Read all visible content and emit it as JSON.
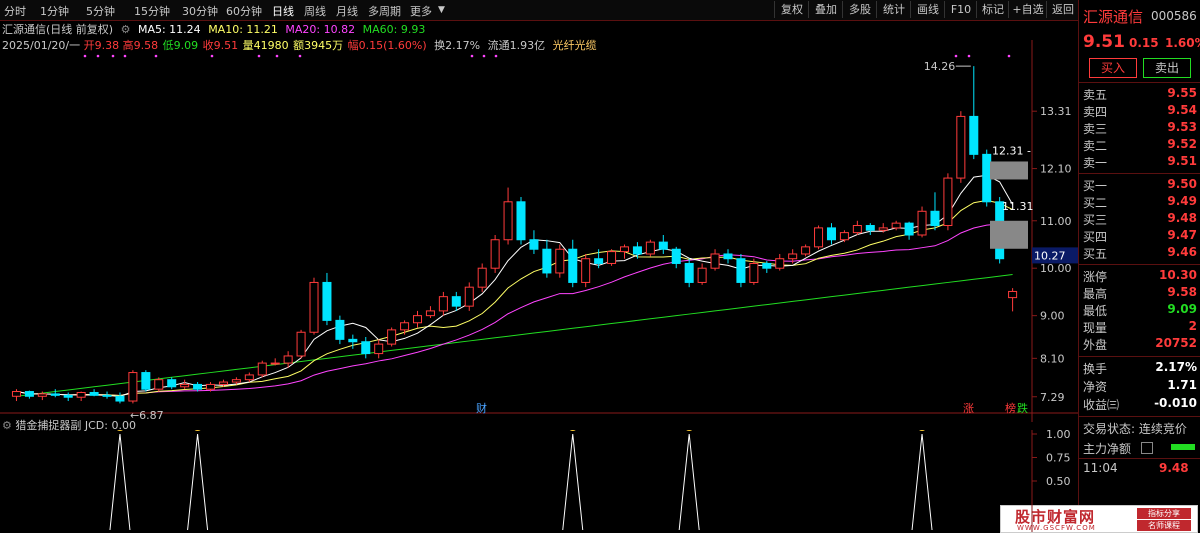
{
  "toolbar": {
    "periods": [
      "分时",
      "1分钟",
      "5分钟",
      "15分钟",
      "30分钟",
      "60分钟",
      "日线",
      "周线",
      "月线",
      "多周期",
      "更多"
    ],
    "active_period": "日线",
    "actions": [
      "复权",
      "叠加",
      "多股",
      "统计",
      "画线",
      "F10",
      "标记",
      "+自选",
      "返回"
    ]
  },
  "info": {
    "name": "汇源通信(日线 前复权)",
    "ma5": "MA5: 11.24",
    "ma10": "MA10: 11.21",
    "ma20": "MA20: 10.82",
    "ma60": "MA60: 9.93",
    "date": "2025/01/20/一",
    "open": "开9.38",
    "high": "高9.58",
    "low": "低9.09",
    "close": "收9.51",
    "volume": "量41980",
    "amount": "额3945万",
    "change": "幅0.15(1.60%)",
    "turnover": "换2.17%",
    "float_mv": "流通1.93亿",
    "concept": "光纤光缆"
  },
  "price_axis": [
    "13.31",
    "12.10",
    "11.00",
    "10.00",
    "9.00",
    "8.10",
    "7.29"
  ],
  "annotations": {
    "high_label": "14.26",
    "low_label": "6.87",
    "current_level": "10.27",
    "l1": "12.31",
    "l2": "11.31",
    "cai": "财",
    "zhang": "涨",
    "bang": "榜",
    "die": "跌"
  },
  "colors": {
    "up": "#ff3b3b",
    "down": "#00e5ff",
    "ma5": "#ffffff",
    "ma10": "#ffff66",
    "ma20": "#ff44ff",
    "ma60": "#22dd22",
    "accent": "#ff3b3b"
  },
  "chart_data": {
    "type": "candlestick",
    "ylim": [
      6.8,
      14.6
    ],
    "candles": [
      [
        7.3,
        7.45,
        7.2,
        7.4
      ],
      [
        7.4,
        7.42,
        7.25,
        7.3
      ],
      [
        7.3,
        7.4,
        7.22,
        7.35
      ],
      [
        7.35,
        7.45,
        7.28,
        7.32
      ],
      [
        7.32,
        7.38,
        7.2,
        7.28
      ],
      [
        7.28,
        7.4,
        7.2,
        7.38
      ],
      [
        7.38,
        7.45,
        7.3,
        7.32
      ],
      [
        7.32,
        7.4,
        7.25,
        7.3
      ],
      [
        7.3,
        7.38,
        7.15,
        7.2
      ],
      [
        7.2,
        7.85,
        7.15,
        7.8
      ],
      [
        7.8,
        7.85,
        7.4,
        7.45
      ],
      [
        7.45,
        7.7,
        7.4,
        7.65
      ],
      [
        7.65,
        7.7,
        7.45,
        7.5
      ],
      [
        7.5,
        7.65,
        7.45,
        7.55
      ],
      [
        7.55,
        7.6,
        7.4,
        7.45
      ],
      [
        7.45,
        7.6,
        7.4,
        7.55
      ],
      [
        7.55,
        7.65,
        7.5,
        7.6
      ],
      [
        7.6,
        7.7,
        7.55,
        7.65
      ],
      [
        7.65,
        7.8,
        7.6,
        7.75
      ],
      [
        7.75,
        8.05,
        7.7,
        8.0
      ],
      [
        8.0,
        8.1,
        7.95,
        8.0
      ],
      [
        8.0,
        8.25,
        7.9,
        8.15
      ],
      [
        8.15,
        8.7,
        8.1,
        8.65
      ],
      [
        8.65,
        9.8,
        8.6,
        9.7
      ],
      [
        9.7,
        9.9,
        8.8,
        8.9
      ],
      [
        8.9,
        9.0,
        8.4,
        8.5
      ],
      [
        8.5,
        8.6,
        8.3,
        8.45
      ],
      [
        8.45,
        8.55,
        8.1,
        8.2
      ],
      [
        8.2,
        8.5,
        8.1,
        8.4
      ],
      [
        8.4,
        8.75,
        8.35,
        8.7
      ],
      [
        8.7,
        8.9,
        8.6,
        8.85
      ],
      [
        8.85,
        9.1,
        8.75,
        9.0
      ],
      [
        9.0,
        9.2,
        8.95,
        9.1
      ],
      [
        9.1,
        9.5,
        9.0,
        9.4
      ],
      [
        9.4,
        9.5,
        9.1,
        9.2
      ],
      [
        9.2,
        9.7,
        9.1,
        9.6
      ],
      [
        9.6,
        10.1,
        9.5,
        10.0
      ],
      [
        10.0,
        10.7,
        9.9,
        10.6
      ],
      [
        10.6,
        11.7,
        10.5,
        11.4
      ],
      [
        11.4,
        11.5,
        10.5,
        10.6
      ],
      [
        10.6,
        10.8,
        10.3,
        10.4
      ],
      [
        10.4,
        10.6,
        9.8,
        9.9
      ],
      [
        9.9,
        10.5,
        9.8,
        10.4
      ],
      [
        10.4,
        10.6,
        9.6,
        9.7
      ],
      [
        9.7,
        10.3,
        9.6,
        10.2
      ],
      [
        10.2,
        10.4,
        10.0,
        10.1
      ],
      [
        10.1,
        10.4,
        10.05,
        10.35
      ],
      [
        10.35,
        10.5,
        10.2,
        10.45
      ],
      [
        10.45,
        10.55,
        10.2,
        10.3
      ],
      [
        10.3,
        10.6,
        10.25,
        10.55
      ],
      [
        10.55,
        10.7,
        10.3,
        10.4
      ],
      [
        10.4,
        10.45,
        10.0,
        10.1
      ],
      [
        10.1,
        10.2,
        9.6,
        9.7
      ],
      [
        9.7,
        10.1,
        9.65,
        10.0
      ],
      [
        10.0,
        10.4,
        9.95,
        10.3
      ],
      [
        10.3,
        10.4,
        10.1,
        10.2
      ],
      [
        10.2,
        10.3,
        9.6,
        9.7
      ],
      [
        9.7,
        10.2,
        9.65,
        10.1
      ],
      [
        10.1,
        10.15,
        9.9,
        10.0
      ],
      [
        10.0,
        10.3,
        9.95,
        10.2
      ],
      [
        10.2,
        10.4,
        10.1,
        10.3
      ],
      [
        10.3,
        10.5,
        10.25,
        10.45
      ],
      [
        10.45,
        10.9,
        10.4,
        10.85
      ],
      [
        10.85,
        10.95,
        10.5,
        10.6
      ],
      [
        10.6,
        10.8,
        10.55,
        10.75
      ],
      [
        10.75,
        11.0,
        10.7,
        10.9
      ],
      [
        10.9,
        10.95,
        10.7,
        10.8
      ],
      [
        10.8,
        10.95,
        10.75,
        10.85
      ],
      [
        10.85,
        11.0,
        10.8,
        10.95
      ],
      [
        10.95,
        10.98,
        10.6,
        10.7
      ],
      [
        10.7,
        11.3,
        10.65,
        11.2
      ],
      [
        11.2,
        11.6,
        10.8,
        10.9
      ],
      [
        10.9,
        12.0,
        10.8,
        11.9
      ],
      [
        11.9,
        13.31,
        11.8,
        13.2
      ],
      [
        13.2,
        14.26,
        12.3,
        12.4
      ],
      [
        12.4,
        12.5,
        11.3,
        11.4
      ],
      [
        11.4,
        11.5,
        10.1,
        10.2
      ],
      [
        9.38,
        9.58,
        9.09,
        9.51
      ]
    ]
  },
  "sub_chart": {
    "title": "猎金捕捉器副",
    "jcd": "JCD: 0.00",
    "axis": [
      "1.00",
      "0.75",
      "0.50"
    ],
    "peaks": [
      8,
      14,
      43,
      52,
      70
    ]
  },
  "quote": {
    "name": "汇源通信",
    "code": "000586",
    "price": "9.51",
    "change": "0.15",
    "pct": "1.60%",
    "buy": "买入",
    "sell": "卖出",
    "asks": [
      {
        "label": "卖五",
        "price": "9.55"
      },
      {
        "label": "卖四",
        "price": "9.54"
      },
      {
        "label": "卖三",
        "price": "9.53"
      },
      {
        "label": "卖二",
        "price": "9.52"
      },
      {
        "label": "卖一",
        "price": "9.51"
      }
    ],
    "bids": [
      {
        "label": "买一",
        "price": "9.50"
      },
      {
        "label": "买二",
        "price": "9.49"
      },
      {
        "label": "买三",
        "price": "9.48"
      },
      {
        "label": "买四",
        "price": "9.47"
      },
      {
        "label": "买五",
        "price": "9.46"
      }
    ],
    "stats": [
      {
        "label": "涨停",
        "value": "10.30"
      },
      {
        "label": "最高",
        "value": "9.58"
      },
      {
        "label": "最低",
        "value": "9.09"
      },
      {
        "label": "现量",
        "value": "2"
      },
      {
        "label": "外盘",
        "value": "20752"
      }
    ],
    "stats2": [
      {
        "label": "换手",
        "value": "2.17%"
      },
      {
        "label": "净资",
        "value": "1.71"
      },
      {
        "label": "收益㈢",
        "value": "-0.010"
      }
    ],
    "trade_state": "交易状态: 连续竞价",
    "main_flow": "主力净额",
    "tick_time": "11:04",
    "tick_price": "9.48"
  },
  "watermark": {
    "cn": "股市财富网",
    "url": "WWW.GSCFW.COM",
    "tag1": "指标分享",
    "tag2": "名师课程"
  }
}
